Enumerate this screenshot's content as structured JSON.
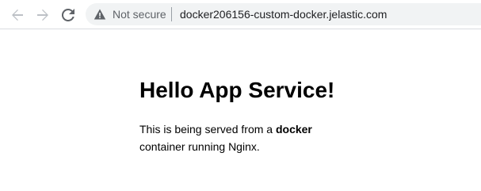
{
  "browser": {
    "security_label": "Not secure",
    "url": "docker206156-custom-docker.jelastic.com",
    "icons": {
      "back": "back-arrow-icon",
      "forward": "forward-arrow-icon",
      "reload": "reload-icon",
      "security": "warning-triangle-icon"
    }
  },
  "page": {
    "heading": "Hello App Service!",
    "text_before": "This is being served from a ",
    "text_bold": "docker",
    "text_after": " container running Nginx."
  }
}
